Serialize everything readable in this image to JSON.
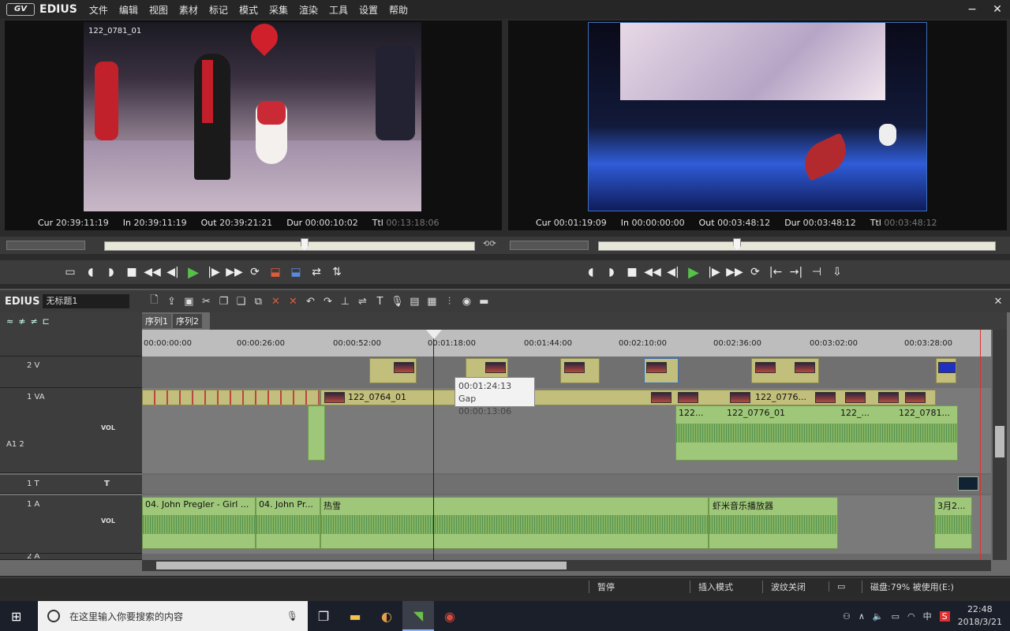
{
  "app": {
    "logo": "GV",
    "name": "EDIUS",
    "menus": [
      "文件",
      "编辑",
      "视图",
      "素材",
      "标记",
      "模式",
      "采集",
      "渲染",
      "工具",
      "设置",
      "帮助"
    ]
  },
  "player": {
    "clip_name": "122_0781_01",
    "cur_label": "Cur",
    "cur": "20:39:11:19",
    "in_label": "In",
    "in": "20:39:11:19",
    "out_label": "Out",
    "out": "20:39:21:21",
    "dur_label": "Dur",
    "dur": "00:00:10:02",
    "ttl_label": "Ttl",
    "ttl": "00:13:18:06",
    "playhead_fraction": 0.54
  },
  "recorder": {
    "cur_label": "Cur",
    "cur": "00:01:19:09",
    "in_label": "In",
    "in": "00:00:00:00",
    "out_label": "Out",
    "out": "00:03:48:12",
    "dur_label": "Dur",
    "dur": "00:03:48:12",
    "ttl_label": "Ttl",
    "ttl": "00:03:48:12",
    "playhead_fraction": 0.35
  },
  "timeline": {
    "brand": "EDIUS",
    "project_name": "无标题1",
    "tabs": [
      "序列1",
      "序列2"
    ],
    "ruler_labels": [
      "00:00:00:00",
      "00:00:26:00",
      "00:00:52:00",
      "00:01:18:00",
      "00:01:44:00",
      "00:02:10:00",
      "00:02:36:00",
      "00:03:02:00",
      "00:03:28:00"
    ],
    "tooltip_time": "00:01:24:13",
    "tooltip_gap": "Gap 00:00:13:06",
    "tracks": {
      "v2": "2 V",
      "va1": "1 VA",
      "a12": "A1 2",
      "t1": "1 T",
      "a1": "1 A",
      "a2": "2 A",
      "vol": "VOL",
      "t_icon": "T"
    },
    "video_clips": {
      "c1": "122_0764_01",
      "c2": "122_0776...",
      "c3": "122...",
      "c4": "122_0776_01",
      "c5": "122_...",
      "c6": "122_0781..."
    },
    "audio_clips": {
      "a1": "04. John Pregler - Girl ...",
      "a2": "04. John Pr...",
      "a3": "热雪",
      "a4": "虾米音乐播放器",
      "a5": "3月2..."
    }
  },
  "status": {
    "pause": "暂停",
    "insert_mode": "插入模式",
    "ripple": "波纹关闭",
    "disk": "磁盘:79% 被使用(E:)"
  },
  "taskbar": {
    "search_placeholder": "在这里输入你要搜索的内容",
    "time": "22:48",
    "date": "2018/3/21",
    "ime": "中"
  },
  "colors": {
    "accent_green": "#57c04a",
    "video_clip": "#c2be7c",
    "audio_clip": "#9fc779",
    "playhead_red": "#e03030"
  }
}
